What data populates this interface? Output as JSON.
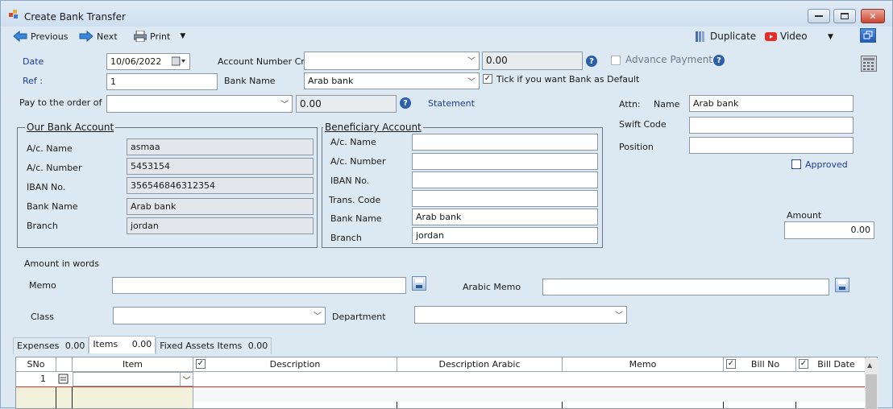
{
  "window": {
    "title": "Create Bank Transfer"
  },
  "toolbar": {
    "previous": "Previous",
    "next": "Next",
    "print": "Print",
    "duplicate": "Duplicate",
    "video": "Video"
  },
  "header": {
    "date_label": "Date",
    "date_value": "10/06/2022",
    "ref_label": "Ref :",
    "ref_value": "1",
    "account_cr_label": "Account Number Cr.",
    "account_cr_value": "",
    "account_cr_amount": "0.00",
    "bank_name_label": "Bank Name",
    "bank_name_value": "Arab bank",
    "advance_payment_label": "Advance Payment",
    "bank_default_label": "Tick if you want Bank as Default",
    "bank_default_checked": true,
    "pay_order_label": "Pay to the order of",
    "pay_order_value": "",
    "pay_order_amount": "0.00",
    "statement_link": "Statement"
  },
  "attn": {
    "attn_label": "Attn:",
    "name_label": "Name",
    "name_value": "Arab bank",
    "swift_label": "Swift Code",
    "swift_value": "",
    "position_label": "Position",
    "position_value": "",
    "approved_label": "Approved",
    "amount_label": "Amount",
    "amount_value": "0.00"
  },
  "our_bank": {
    "title": "Our Bank Account",
    "ac_name_label": "A/c. Name",
    "ac_name_value": "asmaa",
    "ac_number_label": "A/c. Number",
    "ac_number_value": "5453154",
    "iban_label": "IBAN No.",
    "iban_value": "356546846312354",
    "bank_name_label": "Bank Name",
    "bank_name_value": "Arab bank",
    "branch_label": "Branch",
    "branch_value": "jordan"
  },
  "beneficiary": {
    "title": "Beneficiary Account",
    "ac_name_label": "A/c. Name",
    "ac_name_value": "",
    "ac_number_label": "A/c. Number",
    "ac_number_value": "",
    "iban_label": "IBAN No.",
    "iban_value": "",
    "trans_code_label": "Trans. Code",
    "trans_code_value": "",
    "bank_name_label": "Bank Name",
    "bank_name_value": "Arab bank",
    "branch_label": "Branch",
    "branch_value": "jordan"
  },
  "footer_fields": {
    "amount_words_label": "Amount in words",
    "memo_label": "Memo",
    "memo_value": "",
    "arabic_memo_label": "Arabic Memo",
    "arabic_memo_value": "",
    "class_label": "Class",
    "class_value": "",
    "department_label": "Department",
    "department_value": ""
  },
  "tabs": [
    {
      "label": "Expenses",
      "amount": "0.00"
    },
    {
      "label": "Items",
      "amount": "0.00"
    },
    {
      "label": "Fixed Assets Items",
      "amount": "0.00"
    }
  ],
  "grid": {
    "columns": [
      "SNo",
      "",
      "Item",
      "",
      "Description",
      "Description Arabic",
      "Memo",
      "",
      "Bill No",
      "",
      "Bill Date"
    ],
    "first_row_sno": "1"
  }
}
